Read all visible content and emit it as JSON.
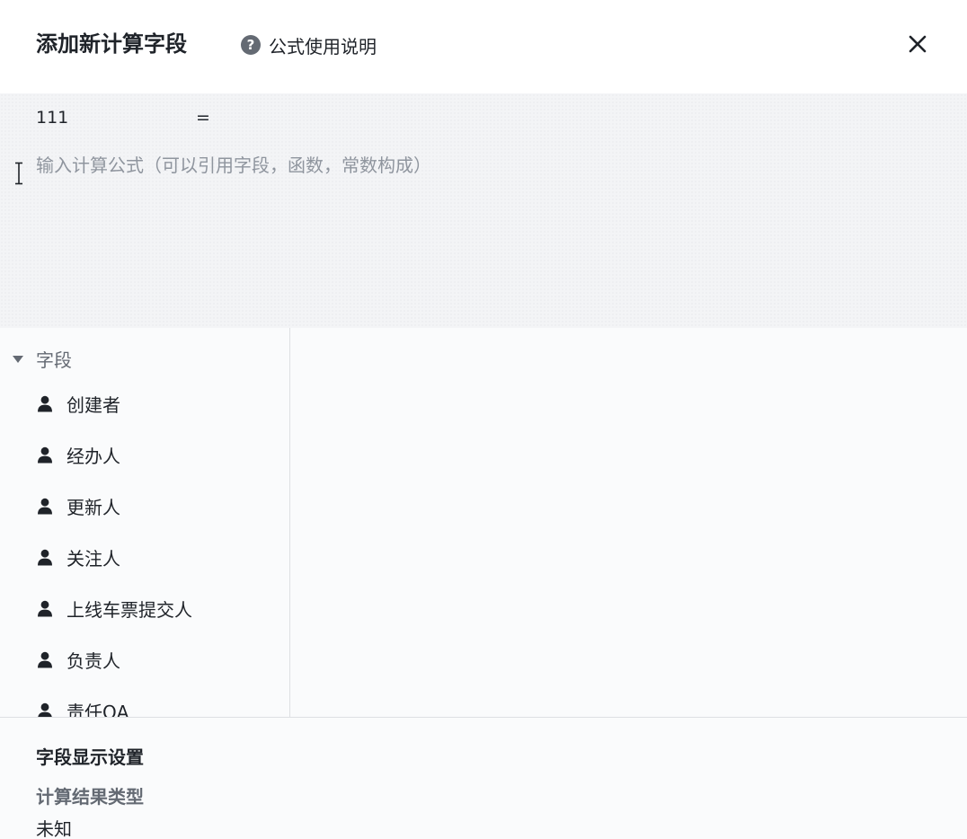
{
  "dialog": {
    "title": "添加新计算字段",
    "help_label": "公式使用说明",
    "help_icon": "question-circle-icon",
    "close_icon": "close-icon"
  },
  "editor": {
    "field_name": "111",
    "equals": "=",
    "placeholder": "输入计算公式（可以引用字段，函数，常数构成）",
    "cursor_icon": "text-cursor-icon"
  },
  "fields": {
    "group_label": "字段",
    "items": [
      {
        "label": "创建者",
        "icon": "person-icon"
      },
      {
        "label": "经办人",
        "icon": "person-icon"
      },
      {
        "label": "更新人",
        "icon": "person-icon"
      },
      {
        "label": "关注人",
        "icon": "person-icon"
      },
      {
        "label": "上线车票提交人",
        "icon": "person-icon"
      },
      {
        "label": "负责人",
        "icon": "person-icon"
      },
      {
        "label": "责任QA",
        "icon": "person-icon"
      }
    ]
  },
  "display_settings": {
    "title": "字段显示设置",
    "result_type_label": "计算结果类型",
    "result_type_value": "未知"
  },
  "colors": {
    "text_primary": "#1f2329",
    "text_secondary": "#646a73",
    "placeholder": "#8f959e",
    "editor_bg": "#f3f4f6",
    "panel_bg": "#fafbfc",
    "divider": "#dee0e3"
  }
}
